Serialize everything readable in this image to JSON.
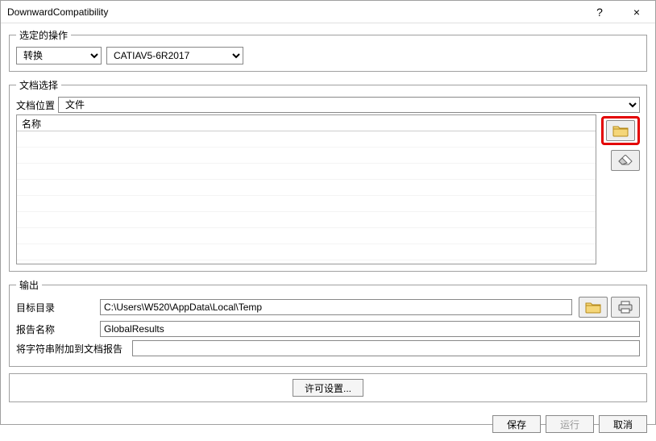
{
  "window": {
    "title": "DownwardCompatibility"
  },
  "titlebar": {
    "help": "?",
    "close": "×"
  },
  "operation": {
    "legend": "选定的操作",
    "action_value": "转换",
    "version_value": "CATIAV5-6R2017"
  },
  "docselect": {
    "legend": "文档选择",
    "location_label": "文档位置",
    "location_value": "文件",
    "name_header": "名称"
  },
  "output": {
    "legend": "输出",
    "target_dir_label": "目标目录",
    "target_dir_value": "C:\\Users\\W520\\AppData\\Local\\Temp",
    "report_name_label": "报告名称",
    "report_name_value": "GlobalResults",
    "append_label": "将字符串附加到文档报告",
    "append_value": ""
  },
  "permissions": {
    "button": "许可设置..."
  },
  "footer": {
    "save": "保存",
    "run": "运行",
    "cancel": "取消"
  },
  "icons": {
    "folder": "folder-icon",
    "eraser": "eraser-icon",
    "printer": "printer-icon"
  }
}
